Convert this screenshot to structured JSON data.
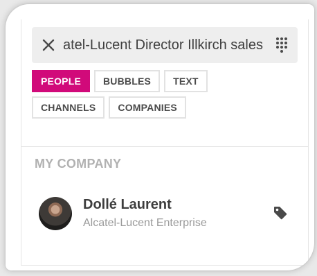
{
  "search": {
    "value": "Alcatel-Lucent Director Illkirch sales"
  },
  "icons": {
    "close": "close-icon",
    "dialpad": "dialpad-icon",
    "tag": "tag-icon"
  },
  "filters": {
    "row1": [
      "PEOPLE",
      "BUBBLES",
      "TEXT"
    ],
    "row2": [
      "CHANNELS",
      "COMPANIES"
    ],
    "active": "PEOPLE"
  },
  "section": {
    "title": "MY COMPANY"
  },
  "contact": {
    "name": "Dollé Laurent",
    "company": "Alcatel-Lucent Enterprise"
  },
  "colors": {
    "accent": "#d10a7a",
    "muted": "#b1b1b1",
    "search_bg": "#eeeeee"
  }
}
